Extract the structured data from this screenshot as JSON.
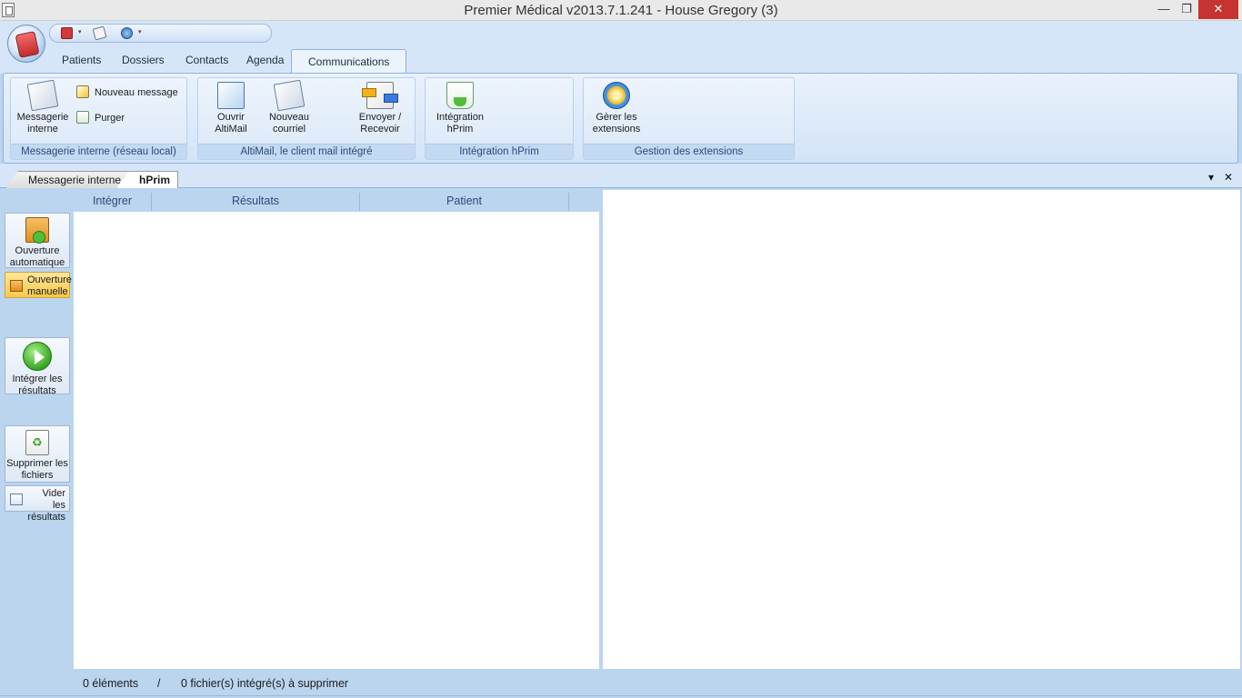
{
  "window": {
    "title": "Premier Médical v2013.7.1.241 - House Gregory (3)",
    "minimize_glyph": "—",
    "maximize_glyph": "❐",
    "close_glyph": "✕"
  },
  "quick_access": {
    "icons": [
      "book-icon",
      "mail-icon",
      "globe-icon"
    ],
    "dropdown_glyph": "▾"
  },
  "tabs": [
    "Patients",
    "Dossiers",
    "Contacts",
    "Agenda",
    "Communications"
  ],
  "ribbon": {
    "groups": [
      {
        "label": "Messagerie interne (réseau local)",
        "big_button": "Messagerie interne",
        "small_buttons": [
          "Nouveau message",
          "Purger"
        ]
      },
      {
        "label": "AltiMail, le client mail intégré",
        "buttons": [
          "Ouvrir AltiMail",
          "Nouveau courriel",
          "Envoyer / Recevoir"
        ]
      },
      {
        "label": "Intégration hPrim",
        "buttons": [
          "Intégration hPrim"
        ]
      },
      {
        "label": "Gestion des extensions",
        "buttons": [
          "Gèrer les extensions"
        ]
      }
    ]
  },
  "doc_tabs": [
    "Messagerie interne",
    "hPrim"
  ],
  "doc_tab_controls": {
    "dropdown": "▾",
    "close": "✕"
  },
  "actions": [
    {
      "label_1": "Ouverture",
      "label_2": "automatique"
    },
    {
      "label_1": "Ouverture",
      "label_2": "manuelle"
    },
    {
      "label_1": "Intégrer les",
      "label_2": "résultats"
    },
    {
      "label_1": "Supprimer les",
      "label_2": "fichiers"
    },
    {
      "label_1": "Vider les",
      "label_2": "résultats"
    }
  ],
  "ribbon_labels": {
    "messagerie_1": "Messagerie",
    "messagerie_2": "interne",
    "ouvrir_1": "Ouvrir",
    "ouvrir_2": "AltiMail",
    "nouveau_1": "Nouveau",
    "nouveau_2": "courriel",
    "envoyer_1": "Envoyer /",
    "envoyer_2": "Recevoir",
    "integration_1": "Intégration",
    "integration_2": "hPrim",
    "gerer_1": "Gèrer les",
    "gerer_2": "extensions"
  },
  "grid": {
    "columns": [
      "Intégrer",
      "Résultats",
      "Patient"
    ]
  },
  "status": {
    "count": "0 éléments",
    "separator": "/",
    "files": "0 fichier(s) intégré(s) à supprimer"
  }
}
